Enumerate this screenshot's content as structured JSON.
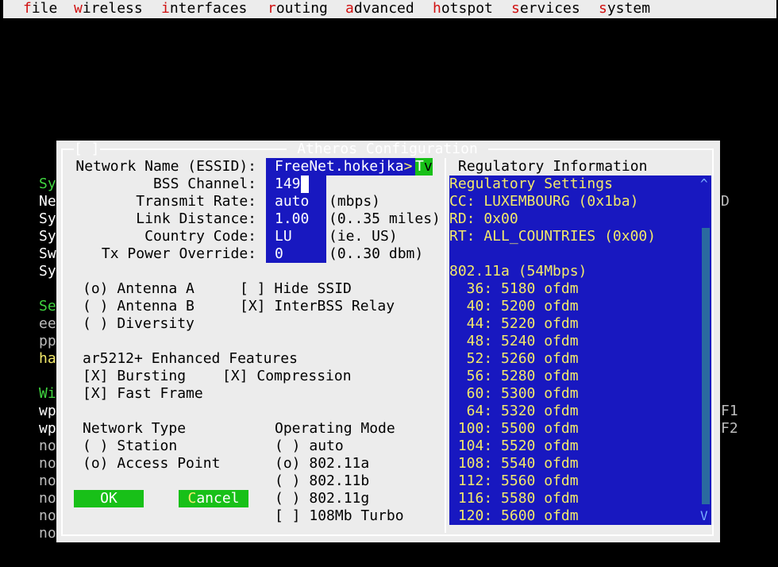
{
  "menu": [
    {
      "hotkey": "f",
      "rest": "ile"
    },
    {
      "hotkey": "w",
      "rest": "ireless"
    },
    {
      "hotkey": "i",
      "rest": "nterfaces"
    },
    {
      "hotkey": "r",
      "rest": "outing"
    },
    {
      "hotkey": "a",
      "rest": "dvanced"
    },
    {
      "hotkey": "h",
      "rest": "otspot"
    },
    {
      "hotkey": "s",
      "rest": "ervices"
    },
    {
      "hotkey": "s",
      "rest": "ystem"
    }
  ],
  "background": {
    "lines": [
      {
        "text": "Sy",
        "color": "green"
      },
      {
        "text": "Ne",
        "color": "white"
      },
      {
        "text": "Sy",
        "color": "white"
      },
      {
        "text": "Sy",
        "color": "white"
      },
      {
        "text": "Sw",
        "color": "white"
      },
      {
        "text": "Sy",
        "color": "white"
      },
      {
        "text": "",
        "color": "white"
      },
      {
        "text": "Se",
        "color": "green"
      },
      {
        "text": "ee",
        "color": "gray"
      },
      {
        "text": "pp",
        "color": "gray"
      },
      {
        "text": "ha",
        "color": "yellow"
      },
      {
        "text": "",
        "color": "white"
      },
      {
        "text": "Wi",
        "color": "green"
      },
      {
        "text": "wp",
        "color": "white"
      },
      {
        "text": "wp",
        "color": "white"
      },
      {
        "text": "no",
        "color": "gray"
      },
      {
        "text": "no",
        "color": "gray"
      },
      {
        "text": "no",
        "color": "gray"
      },
      {
        "text": "no",
        "color": "gray"
      },
      {
        "text": "no",
        "color": "gray"
      },
      {
        "text": "no",
        "color": "gray"
      }
    ],
    "right_d": "D",
    "right_f1": "F1",
    "right_f2": "F2"
  },
  "dialog": {
    "title": "Atheros Configuration",
    "close": "[ ]",
    "fields": {
      "essid": {
        "label": "Network Name (ESSID):",
        "value": "FreeNet.hokejka",
        "overflow": ">",
        "overflow_char": "T",
        "overflow_char2": "v"
      },
      "channel": {
        "label": "BSS Channel:",
        "value": "149"
      },
      "rate": {
        "label": "Transmit Rate:",
        "value": "auto",
        "unit": "(mbps)"
      },
      "distance": {
        "label": "Link Distance:",
        "value": "1.00",
        "unit": "(0..35 miles)"
      },
      "country": {
        "label": "Country Code:",
        "value": "LU",
        "unit": "(ie. US)"
      },
      "power": {
        "label": "Tx Power Override:",
        "value": "0",
        "unit": "(0..30 dbm)"
      }
    },
    "antenna": [
      {
        "mark": "(o)",
        "label": "Antenna A"
      },
      {
        "mark": "( )",
        "label": "Antenna B"
      },
      {
        "mark": "( )",
        "label": "Diversity"
      }
    ],
    "ssid_opts": [
      {
        "mark": "[ ]",
        "label": "Hide SSID"
      },
      {
        "mark": "[X]",
        "label": "InterBSS Relay"
      }
    ],
    "enhanced": {
      "title": "ar5212+ Enhanced Features",
      "bursting": {
        "mark": "[X]",
        "label": "Bursting"
      },
      "compression": {
        "mark": "[X]",
        "label": "Compression"
      },
      "fastframe": {
        "mark": "[X]",
        "label": "Fast Frame"
      }
    },
    "network_type": {
      "title": "Network Type",
      "options": [
        {
          "mark": "( )",
          "label": "Station"
        },
        {
          "mark": "(o)",
          "label": "Access Point"
        }
      ]
    },
    "operating_mode": {
      "title": "Operating Mode",
      "options": [
        {
          "mark": "( )",
          "label": "auto"
        },
        {
          "mark": "(o)",
          "label": "802.11a"
        },
        {
          "mark": "( )",
          "label": "802.11b"
        },
        {
          "mark": "( )",
          "label": "802.11g"
        },
        {
          "mark": "[ ]",
          "label": "108Mb Turbo"
        }
      ]
    },
    "buttons": {
      "ok": "OK",
      "cancel_hotkey": "C",
      "cancel_rest": "ancel"
    },
    "regulatory": {
      "title": "Regulatory Information",
      "lines": [
        "Regulatory Settings",
        "CC: LUXEMBOURG (0x1ba)",
        "RD: 0x00",
        "RT: ALL_COUNTRIES (0x00)",
        "",
        "802.11a (54Mbps)",
        "  36: 5180 ofdm",
        "  40: 5200 ofdm",
        "  44: 5220 ofdm",
        "  48: 5240 ofdm",
        "  52: 5260 ofdm",
        "  56: 5280 ofdm",
        "  60: 5300 ofdm",
        "  64: 5320 ofdm",
        " 100: 5500 ofdm",
        " 104: 5520 ofdm",
        " 108: 5540 ofdm",
        " 112: 5560 ofdm",
        " 116: 5580 ofdm",
        " 120: 5600 ofdm"
      ],
      "scroll_up": "^",
      "scroll_down": "V"
    }
  }
}
